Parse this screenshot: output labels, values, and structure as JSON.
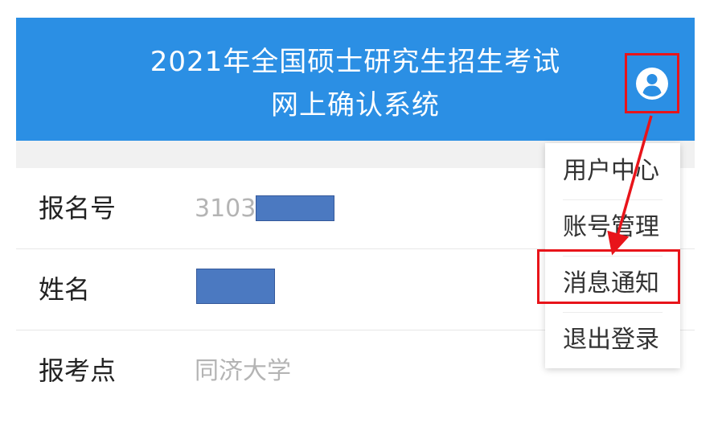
{
  "header": {
    "title_line1": "2021年全国硕士研究生招生考试",
    "title_line2": "网上确认系统",
    "user_icon": "user-circle-icon"
  },
  "info_rows": [
    {
      "label": "报名号",
      "value": "3103"
    },
    {
      "label": "姓名",
      "value": ""
    },
    {
      "label": "报考点",
      "value": "同济大学"
    }
  ],
  "user_menu": {
    "items": [
      {
        "label": "用户中心"
      },
      {
        "label": "账号管理"
      },
      {
        "label": "消息通知"
      },
      {
        "label": "退出登录"
      }
    ]
  },
  "annotation": {
    "highlighted_item": "消息通知",
    "color": "#e8141a"
  },
  "colors": {
    "header_bg": "#2b8fe4",
    "mask": "#4b79c1"
  }
}
